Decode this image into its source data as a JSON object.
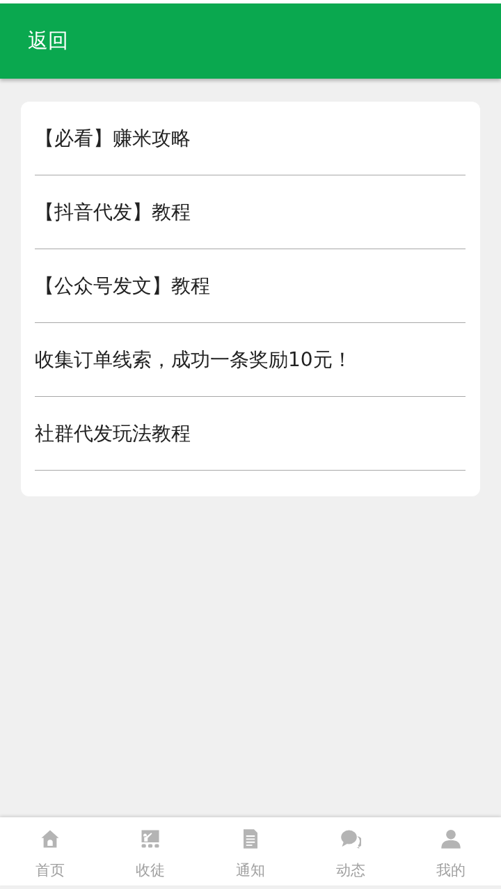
{
  "header": {
    "back": "返回"
  },
  "articles": [
    {
      "title": "【必看】赚米攻略"
    },
    {
      "title": "【抖音代发】教程"
    },
    {
      "title": "【公众号发文】教程"
    },
    {
      "title": "收集订单线索，成功一条奖励10元！"
    },
    {
      "title": "社群代发玩法教程"
    }
  ],
  "tabbar": [
    {
      "label": "首页",
      "selected": false
    },
    {
      "label": "收徒",
      "selected": false
    },
    {
      "label": "通知",
      "selected": false
    },
    {
      "label": "动态",
      "selected": false
    },
    {
      "label": "我的",
      "selected": false
    }
  ]
}
